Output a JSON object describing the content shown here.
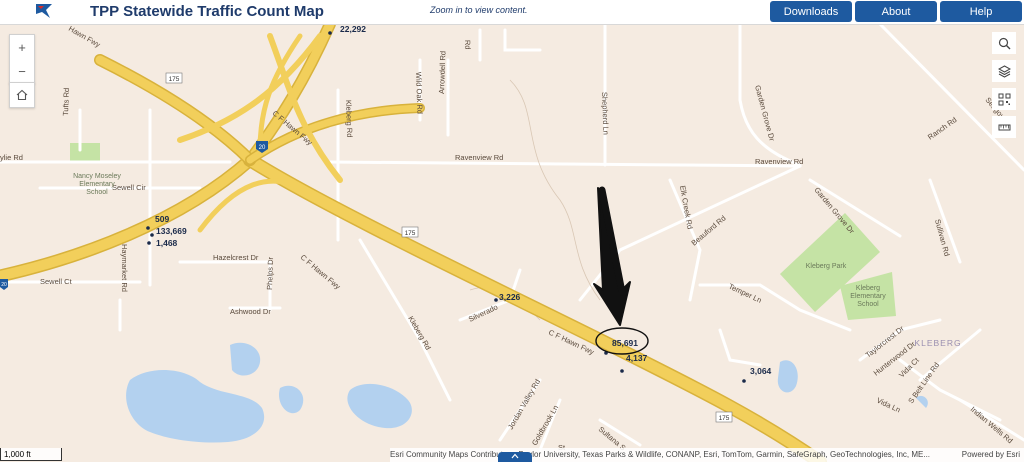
{
  "header": {
    "title": "TPP Statewide Traffic Count Map",
    "zoom_message": "Zoom in to view content.",
    "buttons": {
      "downloads": "Downloads",
      "about": "About",
      "help": "Help"
    },
    "accent_color": "#1e5aa0"
  },
  "map_controls": {
    "zoom_in": "+",
    "zoom_out": "−"
  },
  "right_tools": [
    "search-icon",
    "layers-icon",
    "qr-icon",
    "measure-icon"
  ],
  "roads": {
    "c_f_hawn_fwy": "C F Hawn Fwy",
    "c_f_hawn_fwy_top": "C F Hawn Fwy",
    "c_f_hawn_fwy_nw": "Hawn Fwy",
    "i20_shield": "20",
    "i20_left_shield": "20",
    "us175_top": "175",
    "us175_mid": "175",
    "us175_bottom": "175",
    "c_f_hawn_label_diag": "C F Hawn Fwy",
    "ravenview_left": "Ravenview Rd",
    "ravenview_right": "Ravenview Rd",
    "ravenview_far_left": "ylie Rd",
    "sewell_cir": "Sewell Cir",
    "sewell_ct": "Sewell Ct",
    "hazelcrest": "Hazelcrest Dr",
    "ashwood": "Ashwood Dr",
    "phelps": "Phelps Dr",
    "kleberg_rd_top": "Kleberg Rd",
    "kleberg_rd_mid": "Kleberg Rd",
    "wild_oak": "Wild Oak Rd",
    "arrowdell": "Arrowdell Rd",
    "shepherd": "Shepherd Ln",
    "garden_grove_top": "Garden Grove Dr",
    "garden_grove_mid": "Garden Grove Dr",
    "seagoville": "Seagoville",
    "ranch": "Ranch Rd",
    "sullivan": "Sullivan Rd",
    "elk_creek": "Elk Creek Rd",
    "beauford": "Beauford Rd",
    "temper": "Temper Ln",
    "taylorcrest": "Taylorcrest Dr",
    "hunterwood": "Hunterwood Dr",
    "vida": "Vida Ct",
    "vida_ln": "Vida Ln",
    "s_belt": "S Belt Line Rd",
    "indian_wells": "Indian Wells Rd",
    "jordan_valley": "Jordan Valley Rd",
    "goldbrook": "Goldbrook Ln",
    "sultana": "Sultana S",
    "silverado": "Silverado",
    "haymarket": "Haymarket Rd",
    "tufts": "Tufts Rd",
    "st": "St",
    "rd_top": "Rd"
  },
  "places": {
    "nancy_moseley": [
      "Nancy Moseley",
      "Elementary",
      "School"
    ],
    "kleberg_park": "Kleberg Park",
    "kleberg_school": [
      "Kleberg",
      "Elementary",
      "School"
    ],
    "kleberg_area": "KLEBERG"
  },
  "traffic_counts": {
    "c1": "22,292",
    "c2": "509",
    "c3": "133,669",
    "c4": "1,468",
    "c5": "3,226",
    "c6": "85,691",
    "c7": "4,137",
    "c8": "3,064"
  },
  "annotation": "arrow-pointing-to-85691",
  "scale": "1,000 ft",
  "attribution": {
    "text": "Esri Community Maps Contributors, Baylor University, Texas Parks & Wildlife, CONANP, Esri, TomTom, Garmin, SafeGraph, GeoTechnologies, Inc, ME...",
    "powered": "Powered by Esri"
  },
  "colors": {
    "highway": "#f2cf5b",
    "highway_edge": "#d8b23c",
    "park": "#c5e3a5",
    "water": "#b3d1ef",
    "land": "#f5ebe1",
    "road": "#ffffff"
  }
}
